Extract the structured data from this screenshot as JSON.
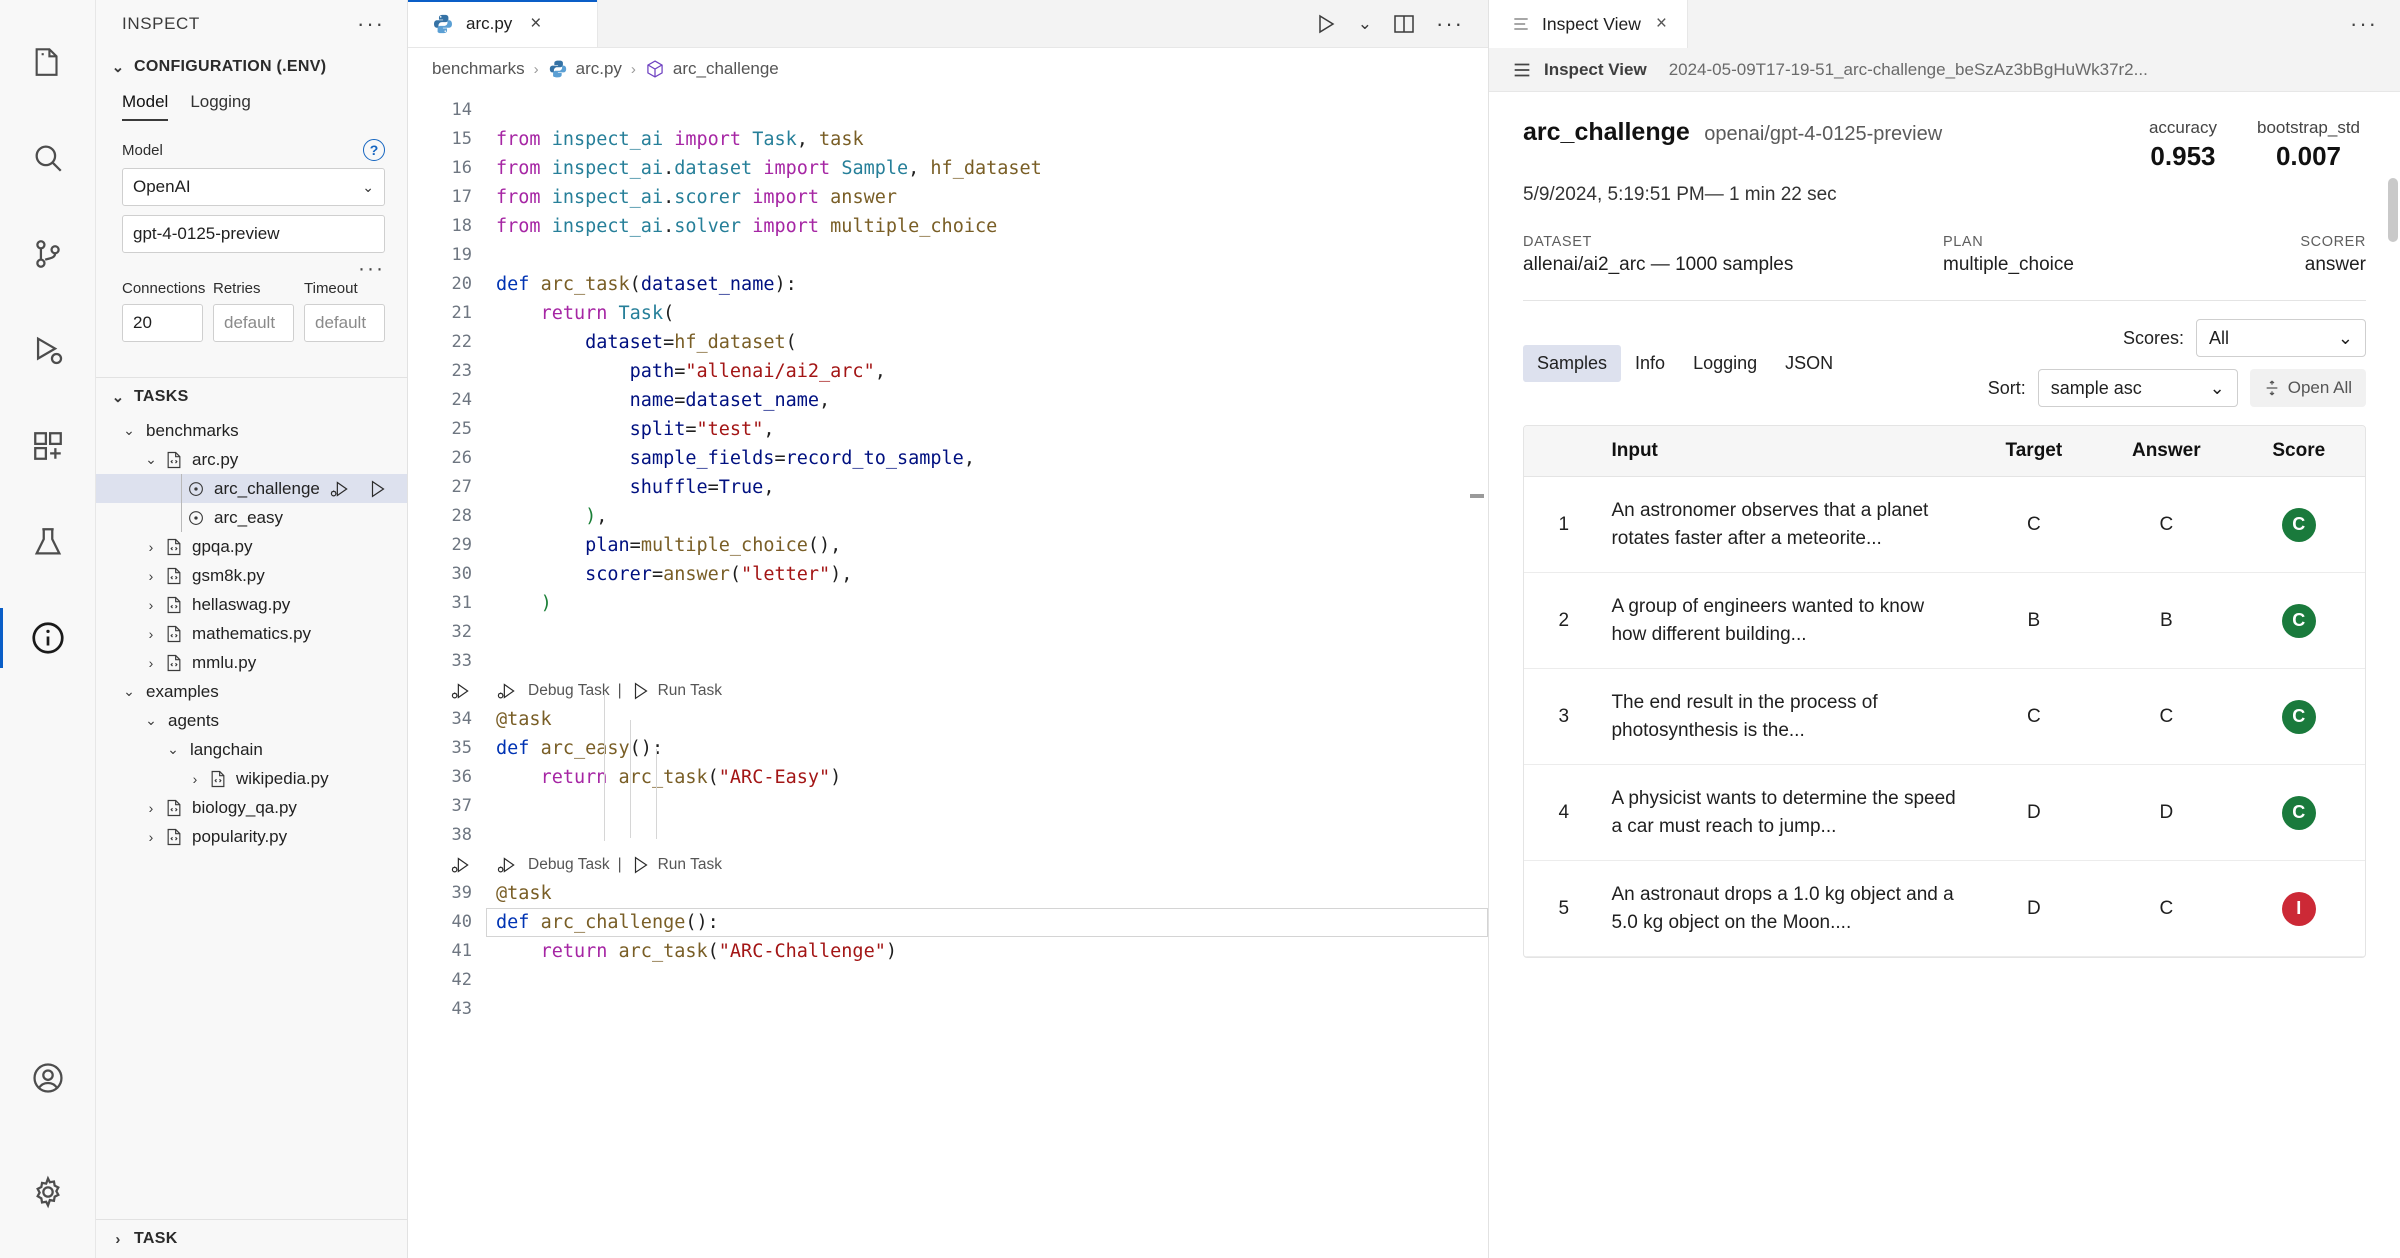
{
  "activity_bar": {
    "items": [
      {
        "name": "explorer",
        "icon": "files-icon"
      },
      {
        "name": "search",
        "icon": "search-icon"
      },
      {
        "name": "source-control",
        "icon": "source-control-icon"
      },
      {
        "name": "run-and-debug",
        "icon": "run-debug-icon"
      },
      {
        "name": "extensions",
        "icon": "extensions-icon"
      },
      {
        "name": "testing",
        "icon": "beaker-icon"
      },
      {
        "name": "inspect",
        "icon": "info-icon",
        "active": true
      }
    ],
    "bottom_items": [
      {
        "name": "accounts",
        "icon": "account-icon"
      },
      {
        "name": "settings",
        "icon": "gear-icon"
      }
    ]
  },
  "sidebar": {
    "title": "INSPECT",
    "more_actions": "···",
    "configuration": {
      "header": "CONFIGURATION (.ENV)",
      "tabs": [
        {
          "label": "Model",
          "active": true
        },
        {
          "label": "Logging",
          "active": false
        }
      ],
      "model_label": "Model",
      "provider_value": "OpenAI",
      "model_value": "gpt-4-0125-preview",
      "more_dots": "···",
      "fields": [
        {
          "label": "Connections",
          "value": "20",
          "placeholder": false
        },
        {
          "label": "Retries",
          "value": "default",
          "placeholder": true
        },
        {
          "label": "Timeout",
          "value": "default",
          "placeholder": true
        }
      ]
    },
    "tasks": {
      "header": "TASKS",
      "tree": [
        {
          "label": "benchmarks",
          "depth": 0,
          "twisty": "down",
          "icon": "none",
          "selected": false
        },
        {
          "label": "arc.py",
          "depth": 1,
          "twisty": "down",
          "icon": "python-file-icon",
          "selected": false
        },
        {
          "label": "arc_challenge",
          "depth": 2,
          "twisty": "none",
          "icon": "task-icon",
          "selected": true,
          "actions": [
            "debug-task-icon",
            "run-task-icon"
          ]
        },
        {
          "label": "arc_easy",
          "depth": 2,
          "twisty": "none",
          "icon": "task-icon",
          "selected": false
        },
        {
          "label": "gpqa.py",
          "depth": 1,
          "twisty": "right",
          "icon": "python-file-icon",
          "selected": false
        },
        {
          "label": "gsm8k.py",
          "depth": 1,
          "twisty": "right",
          "icon": "python-file-icon",
          "selected": false
        },
        {
          "label": "hellaswag.py",
          "depth": 1,
          "twisty": "right",
          "icon": "python-file-icon",
          "selected": false
        },
        {
          "label": "mathematics.py",
          "depth": 1,
          "twisty": "right",
          "icon": "python-file-icon",
          "selected": false
        },
        {
          "label": "mmlu.py",
          "depth": 1,
          "twisty": "right",
          "icon": "python-file-icon",
          "selected": false
        },
        {
          "label": "examples",
          "depth": 0,
          "twisty": "down",
          "icon": "none",
          "selected": false
        },
        {
          "label": "agents",
          "depth": 1,
          "twisty": "down",
          "icon": "none",
          "selected": false
        },
        {
          "label": "langchain",
          "depth": 2,
          "twisty": "down",
          "icon": "none",
          "selected": false
        },
        {
          "label": "wikipedia.py",
          "depth": 3,
          "twisty": "right",
          "icon": "python-file-icon",
          "selected": false
        },
        {
          "label": "biology_qa.py",
          "depth": 1,
          "twisty": "right",
          "icon": "python-file-icon",
          "selected": false
        },
        {
          "label": "popularity.py",
          "depth": 1,
          "twisty": "right",
          "icon": "python-file-icon",
          "selected": false
        }
      ]
    },
    "task_section": {
      "header": "TASK"
    }
  },
  "editor": {
    "tab": {
      "label": "arc.py",
      "icon": "python-icon",
      "close": "×"
    },
    "actions": {
      "run": "run-icon",
      "run_dropdown": "chevron-down-icon",
      "split": "split-editor-icon",
      "more": "···"
    },
    "breadcrumb": [
      "benchmarks",
      "arc.py",
      "arc_challenge"
    ],
    "codelens": {
      "debug": "Debug Task",
      "separator": "|",
      "run": "Run Task"
    },
    "lines": [
      {
        "n": 14,
        "tokens": []
      },
      {
        "n": 15,
        "tokens": [
          [
            "kw",
            "from"
          ],
          [
            "plain",
            " "
          ],
          [
            "mod",
            "inspect_ai"
          ],
          [
            "plain",
            " "
          ],
          [
            "kw",
            "import"
          ],
          [
            "plain",
            " "
          ],
          [
            "cls",
            "Task"
          ],
          [
            "punct",
            ", "
          ],
          [
            "fn",
            "task"
          ]
        ]
      },
      {
        "n": 16,
        "tokens": [
          [
            "kw",
            "from"
          ],
          [
            "plain",
            " "
          ],
          [
            "mod",
            "inspect_ai"
          ],
          [
            "punct",
            "."
          ],
          [
            "mod",
            "dataset"
          ],
          [
            "plain",
            " "
          ],
          [
            "kw",
            "import"
          ],
          [
            "plain",
            " "
          ],
          [
            "cls",
            "Sample"
          ],
          [
            "punct",
            ", "
          ],
          [
            "fn",
            "hf_dataset"
          ]
        ]
      },
      {
        "n": 17,
        "tokens": [
          [
            "kw",
            "from"
          ],
          [
            "plain",
            " "
          ],
          [
            "mod",
            "inspect_ai"
          ],
          [
            "punct",
            "."
          ],
          [
            "mod",
            "scorer"
          ],
          [
            "plain",
            " "
          ],
          [
            "kw",
            "import"
          ],
          [
            "plain",
            " "
          ],
          [
            "fn",
            "answer"
          ]
        ]
      },
      {
        "n": 18,
        "tokens": [
          [
            "kw",
            "from"
          ],
          [
            "plain",
            " "
          ],
          [
            "mod",
            "inspect_ai"
          ],
          [
            "punct",
            "."
          ],
          [
            "mod",
            "solver"
          ],
          [
            "plain",
            " "
          ],
          [
            "kw",
            "import"
          ],
          [
            "plain",
            " "
          ],
          [
            "fn",
            "multiple_choice"
          ]
        ]
      },
      {
        "n": 19,
        "tokens": []
      },
      {
        "n": 20,
        "tokens": [
          [
            "def",
            "def"
          ],
          [
            "plain",
            " "
          ],
          [
            "fn",
            "arc_task"
          ],
          [
            "punct",
            "("
          ],
          [
            "var",
            "dataset_name"
          ],
          [
            "punct",
            "):"
          ]
        ]
      },
      {
        "n": 21,
        "tokens": [
          [
            "plain",
            "    "
          ],
          [
            "kw",
            "return"
          ],
          [
            "plain",
            " "
          ],
          [
            "cls",
            "Task"
          ],
          [
            "punct",
            "("
          ]
        ]
      },
      {
        "n": 22,
        "tokens": [
          [
            "plain",
            "        "
          ],
          [
            "var",
            "dataset"
          ],
          [
            "punct",
            "="
          ],
          [
            "fn",
            "hf_dataset"
          ],
          [
            "punct",
            "("
          ]
        ]
      },
      {
        "n": 23,
        "tokens": [
          [
            "plain",
            "            "
          ],
          [
            "var",
            "path"
          ],
          [
            "punct",
            "="
          ],
          [
            "str",
            "\"allenai/ai2_arc\""
          ],
          [
            "punct",
            ","
          ]
        ]
      },
      {
        "n": 24,
        "tokens": [
          [
            "plain",
            "            "
          ],
          [
            "var",
            "name"
          ],
          [
            "punct",
            "="
          ],
          [
            "var",
            "dataset_name"
          ],
          [
            "punct",
            ","
          ]
        ]
      },
      {
        "n": 25,
        "tokens": [
          [
            "plain",
            "            "
          ],
          [
            "var",
            "split"
          ],
          [
            "punct",
            "="
          ],
          [
            "str",
            "\"test\""
          ],
          [
            "punct",
            ","
          ]
        ]
      },
      {
        "n": 26,
        "tokens": [
          [
            "plain",
            "            "
          ],
          [
            "var",
            "sample_fields"
          ],
          [
            "punct",
            "="
          ],
          [
            "var",
            "record_to_sample"
          ],
          [
            "punct",
            ","
          ]
        ]
      },
      {
        "n": 27,
        "tokens": [
          [
            "plain",
            "            "
          ],
          [
            "var",
            "shuffle"
          ],
          [
            "punct",
            "="
          ],
          [
            "var",
            "True"
          ],
          [
            "punct",
            ","
          ]
        ]
      },
      {
        "n": 28,
        "tokens": [
          [
            "plain",
            "        "
          ],
          [
            "green",
            ")"
          ],
          [
            "punct",
            ","
          ]
        ]
      },
      {
        "n": 29,
        "tokens": [
          [
            "plain",
            "        "
          ],
          [
            "var",
            "plan"
          ],
          [
            "punct",
            "="
          ],
          [
            "fn",
            "multiple_choice"
          ],
          [
            "punct",
            "(),"
          ]
        ]
      },
      {
        "n": 30,
        "tokens": [
          [
            "plain",
            "        "
          ],
          [
            "var",
            "scorer"
          ],
          [
            "punct",
            "="
          ],
          [
            "fn",
            "answer"
          ],
          [
            "punct",
            "("
          ],
          [
            "str",
            "\"letter\""
          ],
          [
            "punct",
            "),"
          ]
        ]
      },
      {
        "n": 31,
        "tokens": [
          [
            "plain",
            "    "
          ],
          [
            "green",
            ")"
          ]
        ]
      },
      {
        "n": 32,
        "tokens": []
      },
      {
        "n": 33,
        "tokens": []
      },
      {
        "n": "lens1",
        "lens": true
      },
      {
        "n": 34,
        "tokens": [
          [
            "fn",
            "@task"
          ]
        ]
      },
      {
        "n": 35,
        "tokens": [
          [
            "def",
            "def"
          ],
          [
            "plain",
            " "
          ],
          [
            "fn",
            "arc_easy"
          ],
          [
            "punct",
            "():"
          ]
        ]
      },
      {
        "n": 36,
        "tokens": [
          [
            "plain",
            "    "
          ],
          [
            "kw",
            "return"
          ],
          [
            "plain",
            " "
          ],
          [
            "fn",
            "arc_task"
          ],
          [
            "punct",
            "("
          ],
          [
            "str",
            "\"ARC-Easy\""
          ],
          [
            "punct",
            ")"
          ]
        ]
      },
      {
        "n": 37,
        "tokens": []
      },
      {
        "n": 38,
        "tokens": []
      },
      {
        "n": "lens2",
        "lens": true
      },
      {
        "n": 39,
        "tokens": [
          [
            "fn",
            "@task"
          ]
        ]
      },
      {
        "n": 40,
        "tokens": [
          [
            "def",
            "def"
          ],
          [
            "plain",
            " "
          ],
          [
            "fn",
            "arc_challenge"
          ],
          [
            "punct",
            "():"
          ]
        ],
        "current": true
      },
      {
        "n": 41,
        "tokens": [
          [
            "plain",
            "    "
          ],
          [
            "kw",
            "return"
          ],
          [
            "plain",
            " "
          ],
          [
            "fn",
            "arc_task"
          ],
          [
            "punct",
            "("
          ],
          [
            "str",
            "\"ARC-Challenge\""
          ],
          [
            "punct",
            ")"
          ]
        ]
      },
      {
        "n": 42,
        "tokens": []
      },
      {
        "n": 43,
        "tokens": []
      }
    ]
  },
  "inspect_view": {
    "tab_label": "Inspect View",
    "tab_close": "×",
    "panel_more": "···",
    "subbar_title": "Inspect View",
    "log_file": "2024-05-09T17-19-51_arc-challenge_beSzAz3bBgHuWk37r2...",
    "eval": {
      "task": "arc_challenge",
      "model": "openai/gpt-4-0125-preview",
      "datetime": "5/9/2024, 5:19:51 PM— 1 min 22 sec",
      "metrics": [
        {
          "name": "accuracy",
          "value": "0.953"
        },
        {
          "name": "bootstrap_std",
          "value": "0.007"
        }
      ],
      "meta": [
        {
          "key": "DATASET",
          "value": "allenai/ai2_arc — 1000 samples"
        },
        {
          "key": "PLAN",
          "value": "multiple_choice"
        },
        {
          "key": "SCORER",
          "value": "answer"
        }
      ]
    },
    "tabs": [
      {
        "label": "Samples",
        "active": true
      },
      {
        "label": "Info",
        "active": false
      },
      {
        "label": "Logging",
        "active": false
      },
      {
        "label": "JSON",
        "active": false
      }
    ],
    "controls": {
      "scores_label": "Scores:",
      "scores_value": "All",
      "sort_label": "Sort:",
      "sort_value": "sample asc",
      "open_all_label": "Open All",
      "open_all_icon": "expand-icon"
    },
    "table": {
      "columns": [
        "",
        "Input",
        "Target",
        "Answer",
        "Score"
      ],
      "rows": [
        {
          "id": "1",
          "input": "An astronomer observes that a planet rotates faster after a meteorite...",
          "target": "C",
          "answer": "C",
          "score": "C",
          "score_kind": "correct"
        },
        {
          "id": "2",
          "input": "A group of engineers wanted to know how different building...",
          "target": "B",
          "answer": "B",
          "score": "C",
          "score_kind": "correct"
        },
        {
          "id": "3",
          "input": "The end result in the process of photosynthesis is the...",
          "target": "C",
          "answer": "C",
          "score": "C",
          "score_kind": "correct"
        },
        {
          "id": "4",
          "input": "A physicist wants to determine the speed a car must reach to jump...",
          "target": "D",
          "answer": "D",
          "score": "C",
          "score_kind": "correct"
        },
        {
          "id": "5",
          "input": "An astronaut drops a 1.0 kg object and a 5.0 kg object on the Moon....",
          "target": "D",
          "answer": "C",
          "score": "I",
          "score_kind": "incorrect"
        }
      ]
    },
    "colors": {
      "correct": "#1a7a3c",
      "incorrect": "#cc2936",
      "accent": "#dde1ee"
    }
  }
}
